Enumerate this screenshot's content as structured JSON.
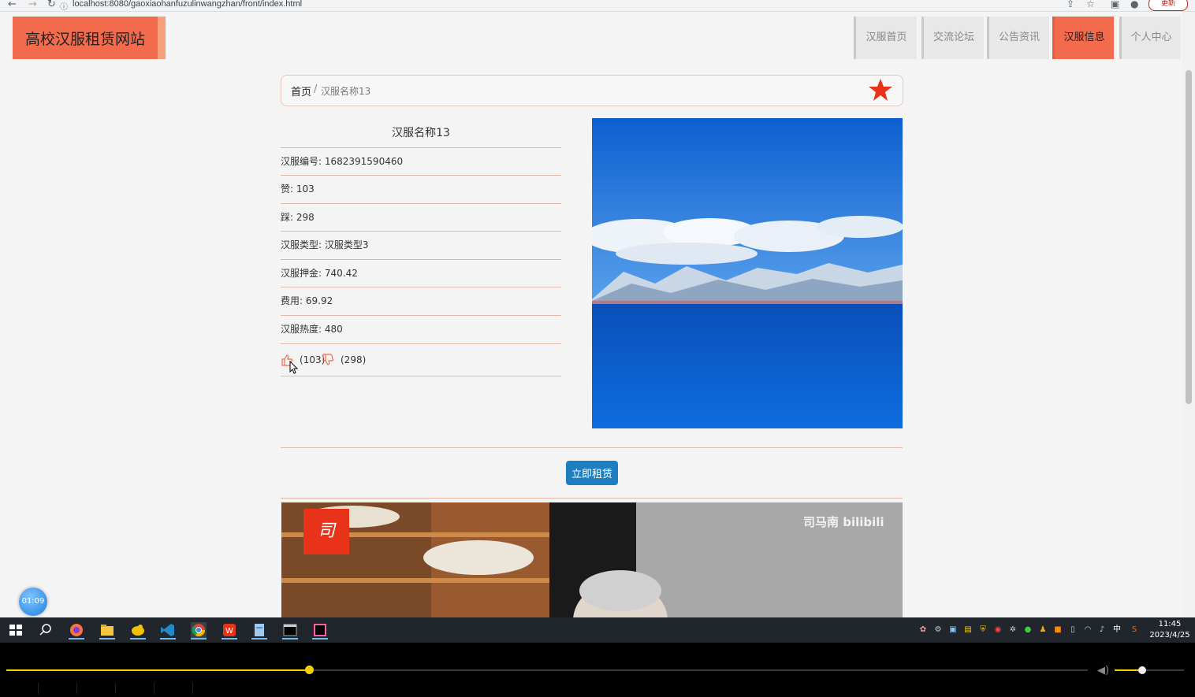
{
  "browser": {
    "url": "localhost:8080/gaoxiaohanfuzulinwangzhan/front/index.html",
    "update_label": "更新"
  },
  "site": {
    "title": "高校汉服租赁网站",
    "nav": [
      {
        "label": "汉服首页",
        "active": false
      },
      {
        "label": "交流论坛",
        "active": false
      },
      {
        "label": "公告资讯",
        "active": false
      },
      {
        "label": "汉服信息",
        "active": true
      },
      {
        "label": "个人中心",
        "active": false
      }
    ]
  },
  "breadcrumb": {
    "home": "首页",
    "separator": "/",
    "current": "汉服名称13"
  },
  "detail": {
    "name": "汉服名称13",
    "fields": [
      {
        "label": "汉服编号: 1682391590460"
      },
      {
        "label": "赞: 103"
      },
      {
        "label": "踩: 298"
      },
      {
        "label": "汉服类型: 汉服类型3"
      },
      {
        "label": "汉服押金: 740.42"
      },
      {
        "label": "费用: 69.92"
      },
      {
        "label": "汉服热度: 480"
      }
    ],
    "like_count": "(103)",
    "dislike_count": "(298)",
    "rent_button": "立即租赁"
  },
  "video_overlay": {
    "badge": "司",
    "watermark": "司马南 bilibili"
  },
  "timer": "01:09",
  "taskbar": {
    "time": "11:45",
    "date": "2023/4/25",
    "ime": "中"
  },
  "player": {
    "progress": 0.28,
    "volume": 0.4
  },
  "colors": {
    "accent": "#f26b4d",
    "button": "#1e7fc0",
    "star": "#e8331a",
    "progress": "#f0d000"
  }
}
